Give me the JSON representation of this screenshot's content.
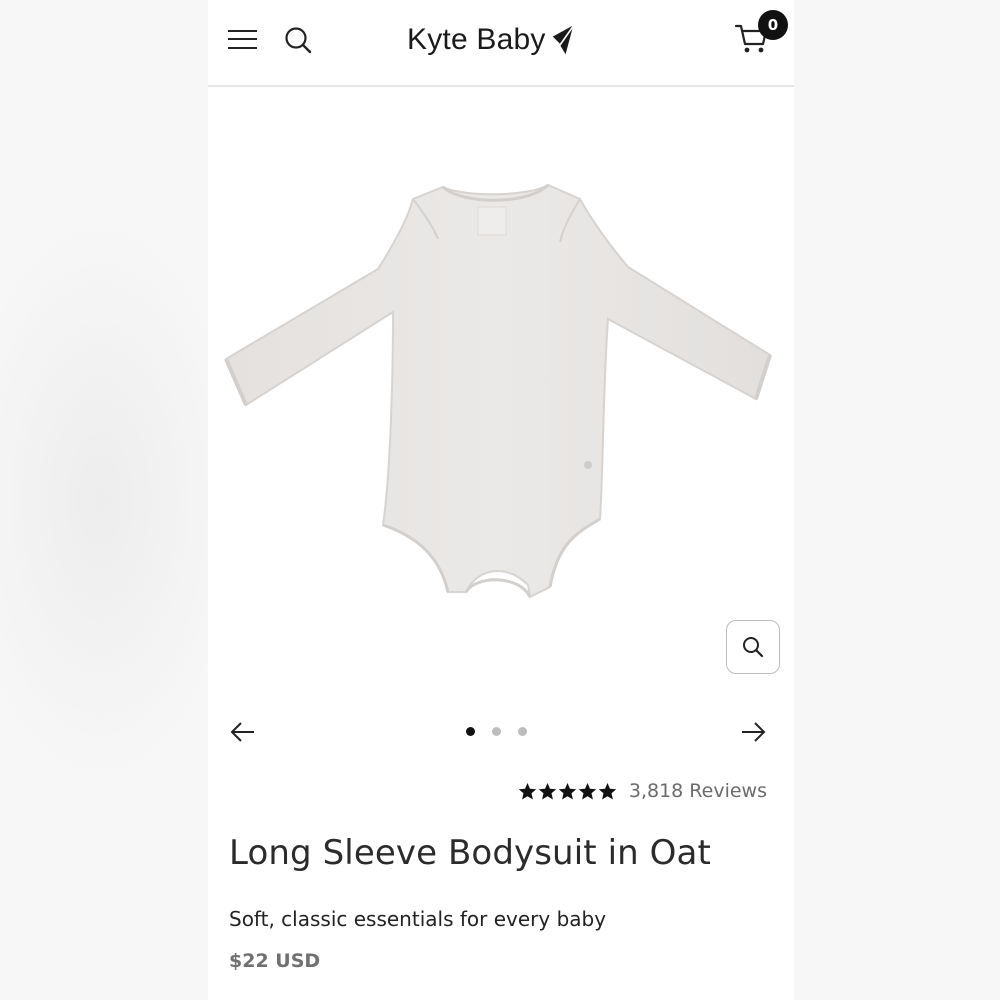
{
  "header": {
    "brand": "Kyte Baby",
    "cart_count": "0"
  },
  "icons": {
    "menu": "hamburger-menu-icon",
    "search": "search-icon",
    "cart": "shopping-cart-icon",
    "zoom": "zoom-icon",
    "prev": "arrow-left-icon",
    "next": "arrow-right-icon",
    "star": "star-icon"
  },
  "gallery": {
    "slide_count": 3,
    "active_index": 0
  },
  "product": {
    "rating_stars": 5,
    "reviews": "3,818 Reviews",
    "title": "Long Sleeve Bodysuit in Oat",
    "subtitle": "Soft, classic essentials for every baby",
    "price": "$22 USD"
  },
  "colors": {
    "text": "#2b2b2b",
    "muted": "#6b6b6b",
    "garment": "#e9e6e4"
  }
}
